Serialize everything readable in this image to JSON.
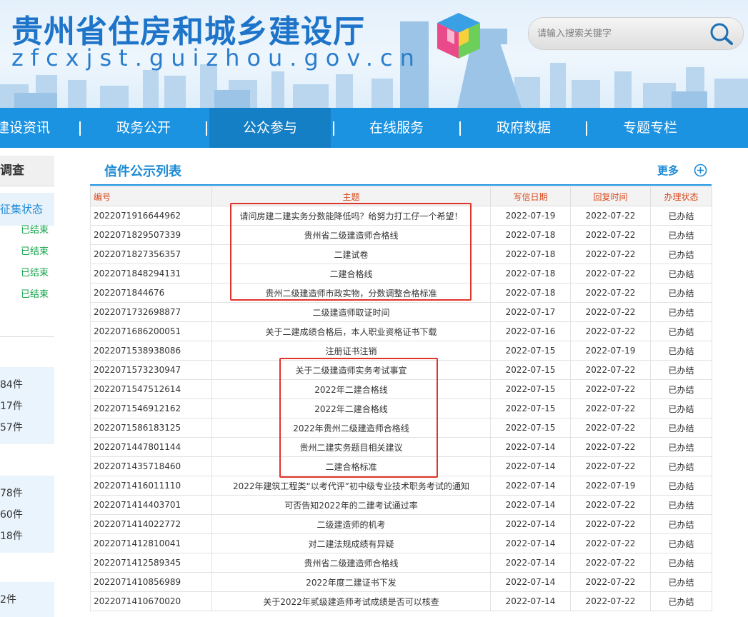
{
  "header": {
    "site_title": "贵州省住房和城乡建设厅",
    "site_domain": "zfcxjst.guizhou.gov.cn",
    "search_placeholder": "请输入搜索关键字"
  },
  "nav": {
    "items": [
      "建设资讯",
      "政务公开",
      "公众参与",
      "在线服务",
      "政府数据",
      "专题专栏"
    ],
    "active": "公众参与"
  },
  "sidebar": {
    "heading": "调查",
    "subheading": "征集状态",
    "status_items": [
      "已结束",
      "已结束",
      "已结束",
      "已结束"
    ],
    "counts_group1": [
      "84件",
      "17件",
      "57件"
    ],
    "counts_group2": [
      "78件",
      "60件",
      "18件"
    ],
    "counts_group3": [
      "2件"
    ]
  },
  "main": {
    "title": "信件公示列表",
    "more": "更多",
    "columns": [
      "编号",
      "主题",
      "写信日期",
      "回复时间",
      "办理状态"
    ],
    "rows": [
      [
        "2022071916644962",
        "请问房建二建实务分数能降低吗？给努力打工仔一个希望！",
        "2022-07-19",
        "2022-07-22",
        "已办结"
      ],
      [
        "2022071829507339",
        "贵州省二级建造师合格线",
        "2022-07-18",
        "2022-07-22",
        "已办结"
      ],
      [
        "2022071827356357",
        "二建试卷",
        "2022-07-18",
        "2022-07-22",
        "已办结"
      ],
      [
        "2022071848294131",
        "二建合格线",
        "2022-07-18",
        "2022-07-22",
        "已办结"
      ],
      [
        "202207184467​6",
        "贵州二级建造师市政实物，分数调整合格标准",
        "2022-07-18",
        "2022-07-22",
        "已办结"
      ],
      [
        "2022071732698877",
        "二级建造师取证时间",
        "2022-07-17",
        "2022-07-22",
        "已办结"
      ],
      [
        "2022071686200051",
        "关于二建成绩合格后，本人职业资格证书下载",
        "2022-07-16",
        "2022-07-22",
        "已办结"
      ],
      [
        "2022071538938086",
        "注册证书注销",
        "2022-07-15",
        "2022-07-19",
        "已办结"
      ],
      [
        "2022071573230947",
        "关于二级建造师实务考试事宜",
        "2022-07-15",
        "2022-07-22",
        "已办结"
      ],
      [
        "2022071547512614",
        "2022年二建合格线",
        "2022-07-15",
        "2022-07-22",
        "已办结"
      ],
      [
        "2022071546912162",
        "2022年二建合格线",
        "2022-07-15",
        "2022-07-22",
        "已办结"
      ],
      [
        "2022071586183125",
        "2022年贵州二级建造师合格线",
        "2022-07-15",
        "2022-07-22",
        "已办结"
      ],
      [
        "2022071447801144",
        "贵州二建实务题目相关建议",
        "2022-07-14",
        "2022-07-22",
        "已办结"
      ],
      [
        "2022071435718460",
        "二建合格标准",
        "2022-07-14",
        "2022-07-22",
        "已办结"
      ],
      [
        "2022071416011110",
        "2022年建筑工程类“以考代评”初中级专业技术职务考试的通知",
        "2022-07-14",
        "2022-07-19",
        "已办结"
      ],
      [
        "2022071414403701",
        "可否告知2022年的二建考试通过率",
        "2022-07-14",
        "2022-07-22",
        "已办结"
      ],
      [
        "2022071414022772",
        "二级建造师的机考",
        "2022-07-14",
        "2022-07-22",
        "已办结"
      ],
      [
        "2022071412810041",
        "对二建法规成绩有异疑",
        "2022-07-14",
        "2022-07-22",
        "已办结"
      ],
      [
        "2022071412589345",
        "贵州省二级建造师合格线",
        "2022-07-14",
        "2022-07-22",
        "已办结"
      ],
      [
        "2022071410856989",
        "2022年度二建证书下发",
        "2022-07-14",
        "2022-07-22",
        "已办结"
      ],
      [
        "2022071410670020",
        "关于2022年贰级建造师考试成绩是否可以核查",
        "2022-07-14",
        "2022-07-22",
        "已办结"
      ]
    ]
  },
  "colors": {
    "brand_blue": "#1b93e1",
    "header_red_text": "#d9481c",
    "highlight_box": "#e0342a",
    "status_green": "#16a34a"
  }
}
